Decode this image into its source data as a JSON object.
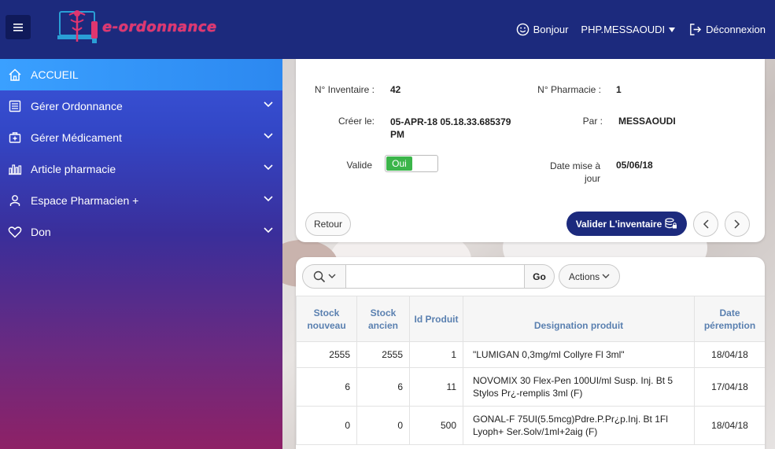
{
  "header": {
    "app_name": "e-ordonnance",
    "greeting": "Bonjour",
    "user": "PHP.MESSAOUDI",
    "logout": "Déconnexion"
  },
  "sidebar": {
    "items": [
      {
        "label": "ACCUEIL",
        "icon": "home-icon"
      },
      {
        "label": "Gérer Ordonnance",
        "icon": "list-icon"
      },
      {
        "label": "Gérer Médicament",
        "icon": "medical-case-icon"
      },
      {
        "label": "Article pharmacie",
        "icon": "chart-icon"
      },
      {
        "label": "Espace Pharmacien +",
        "icon": "user-icon"
      },
      {
        "label": "Don",
        "icon": "heart-icon"
      }
    ]
  },
  "form": {
    "inventaire_label": "N° Inventaire :",
    "inventaire_value": "42",
    "pharmacie_label": "N° Pharmacie :",
    "pharmacie_value": "1",
    "cree_label": "Créer le:",
    "cree_value": "05-APR-18 05.18.33.685379 PM",
    "par_label": "Par :",
    "par_value": "MESSAOUDI",
    "valide_label": "Valide",
    "valide_value": "Oui",
    "date_maj_label": "Date mise à jour",
    "date_maj_value": "05/06/18",
    "retour": "Retour",
    "valider": "Valider L'inventaire"
  },
  "toolbar": {
    "search_value": "",
    "go": "Go",
    "actions": "Actions"
  },
  "table": {
    "columns": [
      "Stock nouveau",
      "Stock ancien",
      "Id Produit",
      "Designation produit",
      "Date péremption"
    ],
    "rows": [
      [
        "2555",
        "2555",
        "1",
        "\"LUMIGAN 0,3mg/ml Collyre Fl 3ml\"",
        "18/04/18"
      ],
      [
        "6",
        "6",
        "11",
        "NOVOMIX 30 Flex-Pen 100UI/ml Susp. Inj. Bt 5 Stylos Pr¿-remplis 3ml (F)",
        "17/04/18"
      ],
      [
        "0",
        "0",
        "500",
        "GONAL-F 75UI(5.5mcg)Pdre.P.Pr¿p.Inj. Bt 1Fl Lyoph+ Ser.Solv/1ml+2aig (F)",
        "18/04/18"
      ]
    ]
  }
}
